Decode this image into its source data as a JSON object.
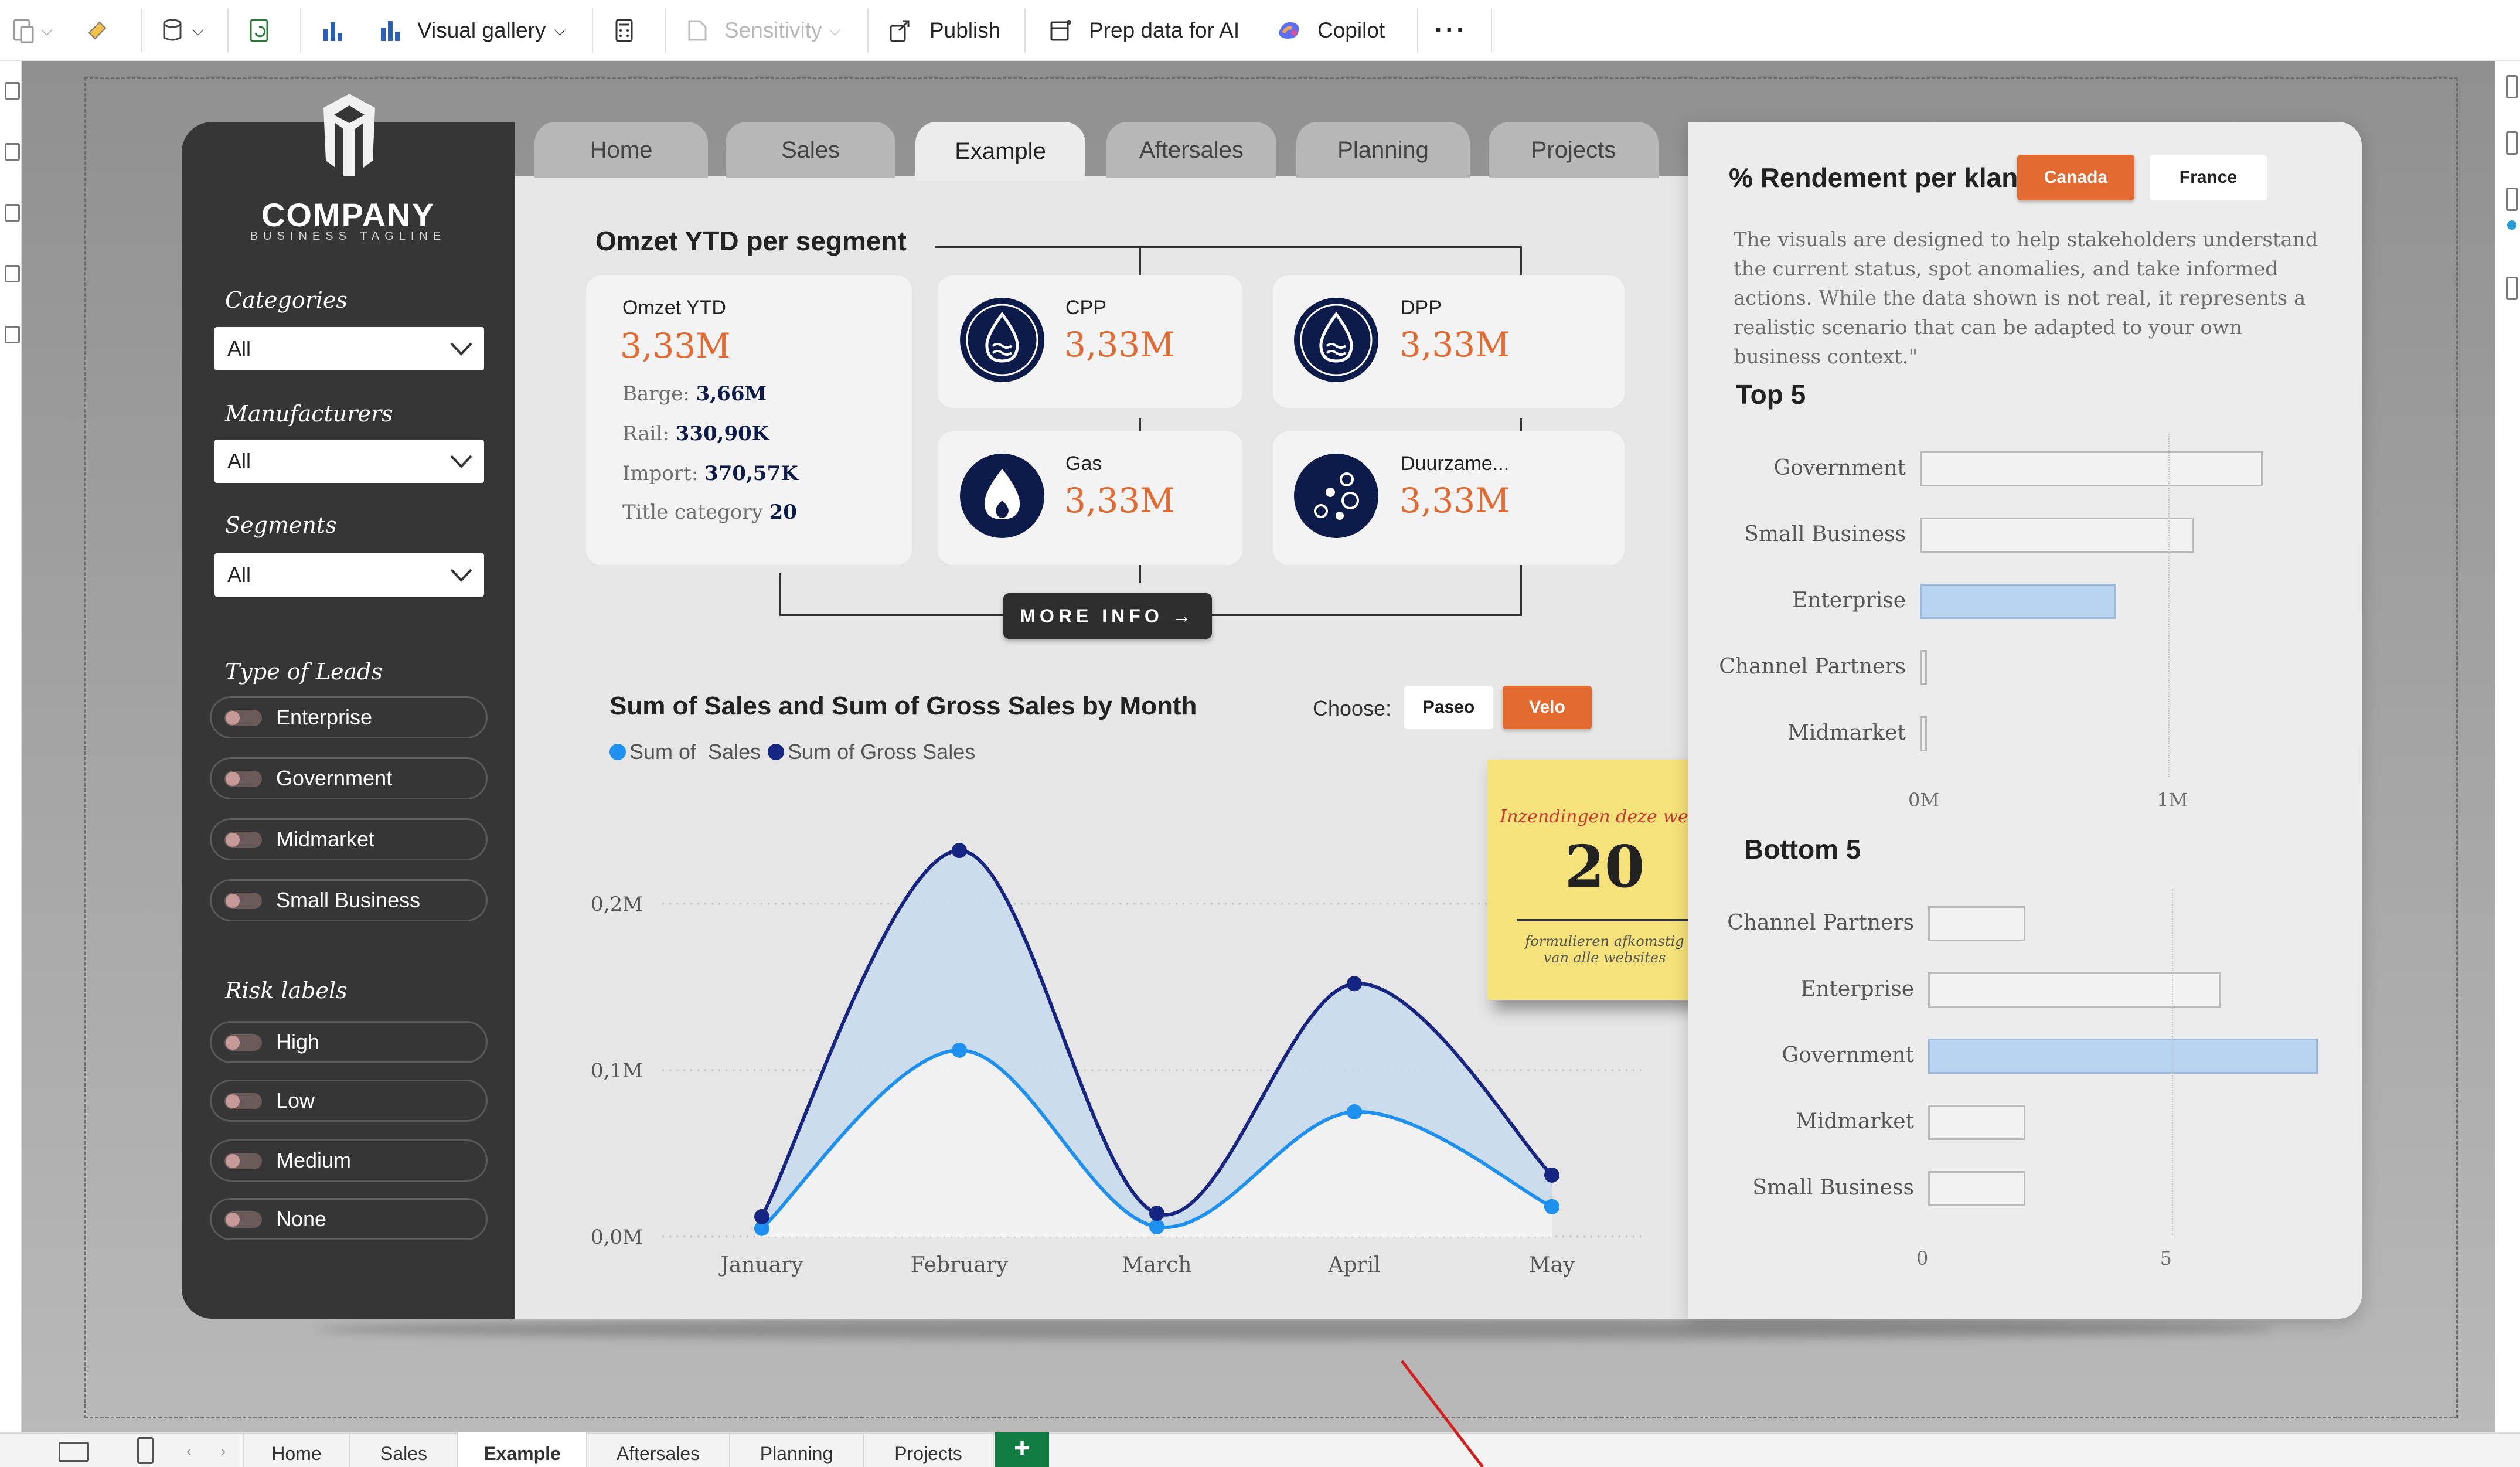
{
  "ribbon": {
    "visual_gallery": "Visual gallery",
    "sensitivity": "Sensitivity",
    "publish": "Publish",
    "prep_data": "Prep data for AI",
    "copilot": "Copilot",
    "more": "···"
  },
  "report_tabs": [
    "Home",
    "Sales",
    "Example",
    "Aftersales",
    "Planning",
    "Projects"
  ],
  "active_tab": "Example",
  "logo": {
    "name": "COMPANY",
    "tagline": "BUSINESS TAGLINE"
  },
  "filters": {
    "categories": {
      "label": "Categories",
      "value": "All"
    },
    "manufacturers": {
      "label": "Manufacturers",
      "value": "All"
    },
    "segments": {
      "label": "Segments",
      "value": "All"
    }
  },
  "type_of_leads": {
    "label": "Type of Leads",
    "items": [
      "Enterprise",
      "Government",
      "Midmarket",
      "Small Business"
    ]
  },
  "risk_labels": {
    "label": "Risk labels",
    "items": [
      "High",
      "Low",
      "Medium",
      "None"
    ]
  },
  "omzet": {
    "title": "Omzet YTD per segment",
    "main_label": "Omzet YTD",
    "main_value": "3,33M",
    "details": [
      {
        "label": "Barge:",
        "value": "3,66M"
      },
      {
        "label": "Rail:",
        "value": "330,90K"
      },
      {
        "label": "Import:",
        "value": "370,57K"
      },
      {
        "label": "Title category",
        "value": "20"
      }
    ],
    "cards": [
      {
        "name": "CPP",
        "value": "3,33M",
        "icon": "water-drop-wave-icon"
      },
      {
        "name": "DPP",
        "value": "3,33M",
        "icon": "water-drop-wave-icon"
      },
      {
        "name": "Gas",
        "value": "3,33M",
        "icon": "flame-drop-icon"
      },
      {
        "name": "Duurzame...",
        "value": "3,33M",
        "icon": "bubbles-icon"
      }
    ],
    "more_info": "MORE INFO →"
  },
  "chart_data": {
    "type": "line",
    "title": "Sum of Sales and Sum of Gross Sales by Month",
    "categories": [
      "January",
      "February",
      "March",
      "April",
      "May"
    ],
    "series": [
      {
        "name": "Sum of  Sales",
        "color": "#1e90f0",
        "values": [
          0.005,
          0.112,
          0.006,
          0.075,
          0.018
        ]
      },
      {
        "name": "Sum of Gross Sales",
        "color": "#172582",
        "values": [
          0.012,
          0.232,
          0.014,
          0.152,
          0.037
        ]
      }
    ],
    "yticks": [
      "0,0M",
      "0,1M",
      "0,2M"
    ],
    "ylim": [
      0,
      0.25
    ],
    "area_fill": "#c7d9ec",
    "grid": true,
    "legend": "top-left"
  },
  "choose": {
    "label": "Choose:",
    "options": [
      "Paseo",
      "Velo"
    ],
    "selected": "Velo"
  },
  "sticky": {
    "title": "Inzendingen deze week",
    "value": "20",
    "subtitle_1": "formulieren afkomstig",
    "subtitle_2": "van alle websites"
  },
  "rendement": {
    "title": "% Rendement per klant",
    "buttons": [
      "Canada",
      "France"
    ],
    "selected": "Canada",
    "description": "The visuals are designed to help stakeholders understand the current status, spot anomalies, and take informed actions. While the data shown is not real, it represents a realistic scenario that can be adapted to your own business context.\"",
    "top5": {
      "title": "Top 5",
      "categories": [
        "Government",
        "Small Business",
        "Enterprise",
        "Channel Partners",
        "Midmarket"
      ],
      "values": [
        1.38,
        1.1,
        0.79,
        0.02,
        0.01
      ],
      "highlight": "Enterprise",
      "ticks": [
        "0M",
        "1M"
      ],
      "xlim": [
        0,
        1.65
      ]
    },
    "bottom5": {
      "title": "Bottom 5",
      "categories": [
        "Channel Partners",
        "Enterprise",
        "Government",
        "Midmarket",
        "Small Business"
      ],
      "values": [
        2,
        6,
        8,
        2,
        2
      ],
      "highlight": "Government",
      "ticks": [
        "0",
        "5"
      ],
      "xlim": [
        0,
        8.3
      ]
    }
  },
  "bottom_tabs": [
    "Home",
    "Sales",
    "Example",
    "Aftersales",
    "Planning",
    "Projects"
  ],
  "bottom_add": "+",
  "colors": {
    "accent": "#e2692f",
    "navy": "#0d1b4b",
    "sidebar": "#363636"
  }
}
